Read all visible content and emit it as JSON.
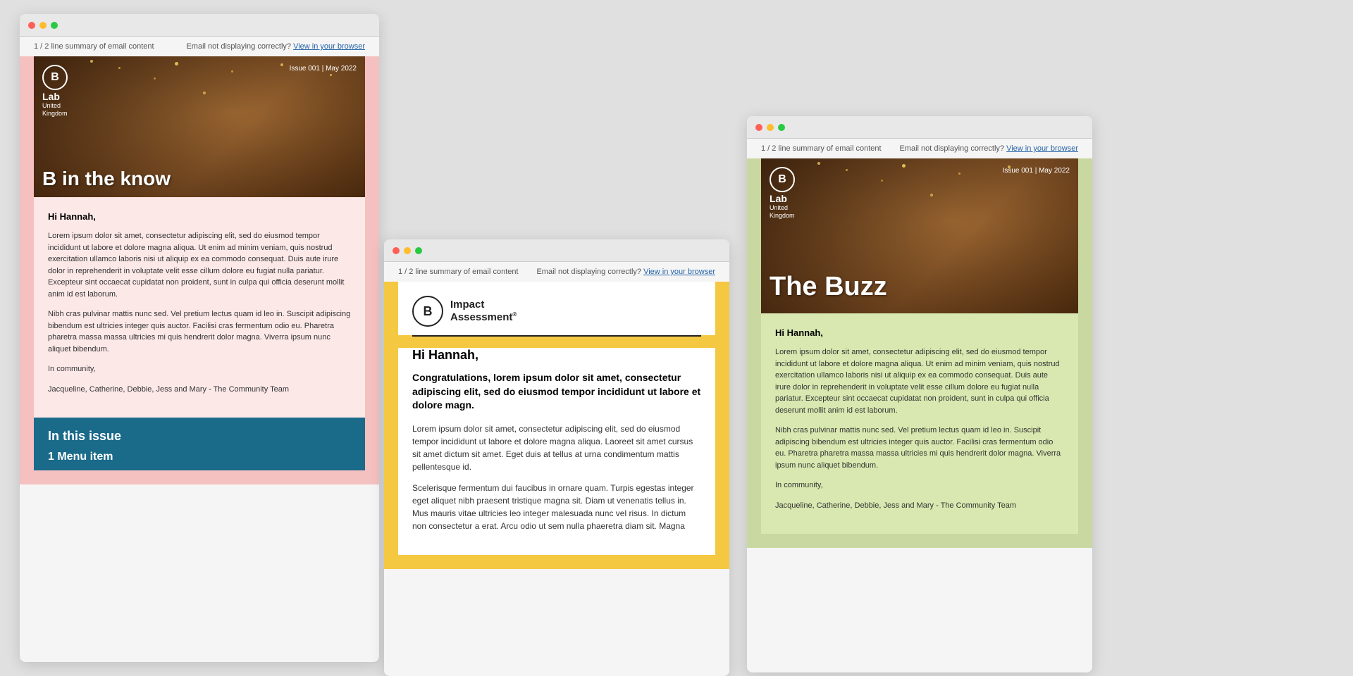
{
  "page": {
    "background": "#e0e0e0"
  },
  "windows": [
    {
      "id": "window-1",
      "position": "left",
      "background_color": "#f5c0c0",
      "topbar": {
        "summary_text": "1 / 2 line summary of email content",
        "not_displaying_text": "Email not displaying correctly?",
        "view_link": "View in your browser"
      },
      "hero": {
        "issue_label": "Issue 001 | May 2022",
        "logo_letter": "B",
        "logo_text": "Lab",
        "logo_subtext": "United\nKingdom",
        "title": "B in the know"
      },
      "body": {
        "greeting": "Hi Hannah,",
        "paragraphs": [
          "Lorem ipsum dolor sit amet, consectetur adipiscing elit, sed do eiusmod tempor incididunt ut labore et dolore magna aliqua. Ut enim ad minim veniam, quis nostrud exercitation ullamco laboris nisi ut aliquip ex ea commodo consequat. Duis aute irure dolor in reprehenderit in voluptate velit esse cillum dolore eu fugiat nulla pariatur. Excepteur sint occaecat cupidatat non proident, sunt in culpa qui officia deserunt mollit anim id est laborum.",
          "Nibh cras pulvinar mattis nunc sed. Vel pretium lectus quam id leo in. Suscipit adipiscing bibendum est ultricies integer quis auctor. Facilisi cras fermentum odio eu. Pharetra pharetra massa massa ultricies mi quis hendrerit dolor magna. Viverra ipsum nunc aliquet bibendum.",
          "In community,",
          "Jacqueline, Catherine, Debbie, Jess and Mary - The Community Team"
        ]
      },
      "in_this_issue": {
        "title": "In this issue",
        "item": "1 Menu item"
      }
    },
    {
      "id": "window-2",
      "position": "middle",
      "background_color": "#f5c842",
      "topbar": {
        "summary_text": "1 / 2 line summary of email content",
        "not_displaying_text": "Email not displaying correctly?",
        "view_link": "View in your browser"
      },
      "bia": {
        "logo_letter": "B",
        "logo_text": "Impact\nAssessment",
        "logo_trademark": "®"
      },
      "body": {
        "greeting": "Hi Hannah,",
        "congrats": "Congratulations, lorem ipsum dolor sit amet, consectetur adipiscing elit, sed do eiusmod tempor incididunt ut labore et dolore magn.",
        "paragraphs": [
          "Lorem ipsum dolor sit amet, consectetur adipiscing elit, sed do eiusmod tempor incididunt ut labore et dolore magna aliqua. Laoreet sit amet cursus sit amet dictum sit amet. Eget duis at tellus at urna condimentum mattis pellentesque id.",
          "Scelerisque fermentum dui faucibus in ornare quam. Turpis egestas integer eget aliquet nibh praesent tristique magna sit. Diam ut venenatis tellus in. Mus mauris vitae ultricies leo integer malesuada nunc vel risus. In dictum non consectetur a erat. Arcu odio ut sem nulla phaeretra diam sit. Magna"
        ]
      }
    },
    {
      "id": "window-3",
      "position": "right",
      "background_color": "#c8d8a0",
      "topbar": {
        "summary_text": "1 / 2 line summary of email content",
        "not_displaying_text": "Email not displaying correctly?",
        "view_link": "View in your browser"
      },
      "hero": {
        "issue_label": "Issue 001 | May 2022",
        "logo_letter": "B",
        "logo_text": "Lab",
        "logo_subtext": "United\nKingdom",
        "title": "The Buzz"
      },
      "body": {
        "greeting": "Hi Hannah,",
        "paragraphs": [
          "Lorem ipsum dolor sit amet, consectetur adipiscing elit, sed do eiusmod tempor incididunt ut labore et dolore magna aliqua. Ut enim ad minim veniam, quis nostrud exercitation ullamco laboris nisi ut aliquip ex ea commodo consequat. Duis aute irure dolor in reprehenderit in voluptate velit esse cillum dolore eu fugiat nulla pariatur. Excepteur sint occaecat cupidatat non proident, sunt in culpa qui officia deserunt mollit anim id est laborum.",
          "Nibh cras pulvinar mattis nunc sed. Vel pretium lectus quam id leo in. Suscipit adipiscing bibendum est ultricies integer quis auctor. Facilisi cras fermentum odio eu. Pharetra pharetra massa massa ultricies mi quis hendrerit dolor magna. Viverra ipsum nunc aliquet bibendum.",
          "In community,",
          "Jacqueline, Catherine, Debbie, Jess and Mary - The Community Team"
        ]
      }
    }
  ]
}
